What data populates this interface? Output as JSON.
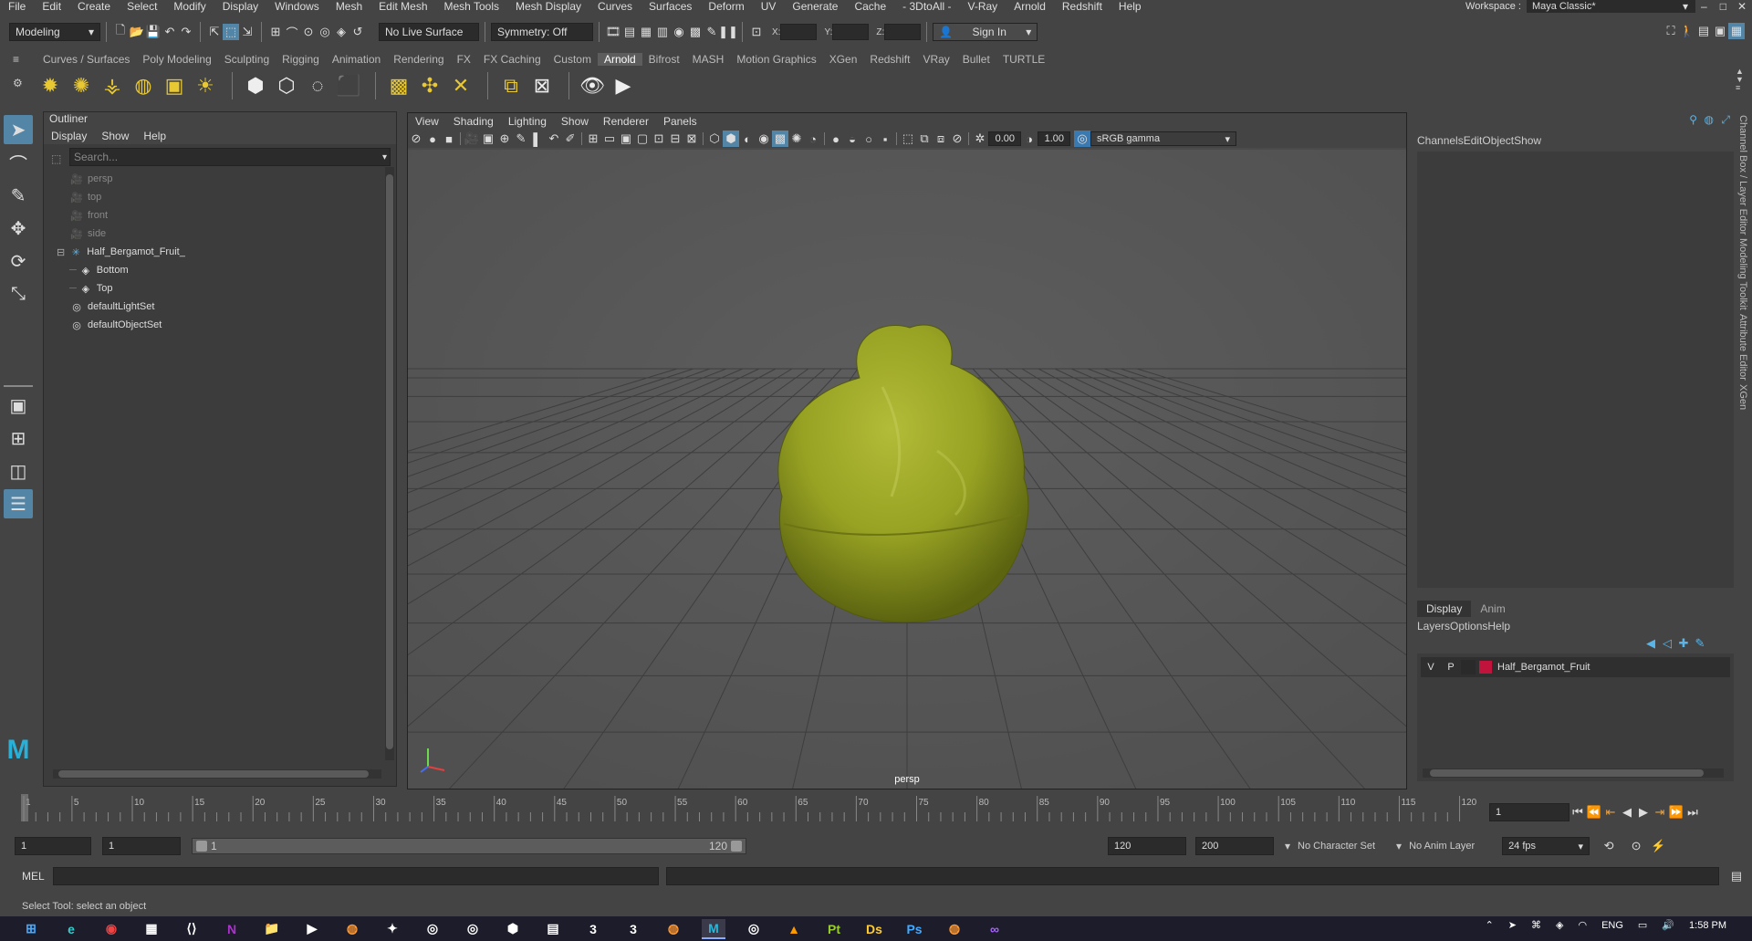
{
  "menubar": {
    "items": [
      "File",
      "Edit",
      "Create",
      "Select",
      "Modify",
      "Display",
      "Windows",
      "Mesh",
      "Edit Mesh",
      "Mesh Tools",
      "Mesh Display",
      "Curves",
      "Surfaces",
      "Deform",
      "UV",
      "Generate",
      "Cache",
      "- 3DtoAll -",
      "V-Ray",
      "Arnold",
      "Redshift",
      "Help"
    ],
    "workspace_label": "Workspace :",
    "workspace_value": "Maya Classic*"
  },
  "statusline": {
    "mode": "Modeling",
    "live_surface": "No Live Surface",
    "symmetry": "Symmetry: Off",
    "x_label": "X:",
    "y_label": "Y:",
    "z_label": "Z:",
    "sign_in": "Sign In"
  },
  "shelf": {
    "tabs": [
      "Curves / Surfaces",
      "Poly Modeling",
      "Sculpting",
      "Rigging",
      "Animation",
      "Rendering",
      "FX",
      "FX Caching",
      "Custom",
      "Arnold",
      "Bifrost",
      "MASH",
      "Motion Graphics",
      "XGen",
      "Redshift",
      "VRay",
      "Bullet",
      "TURTLE"
    ],
    "active_tab": "Arnold"
  },
  "outliner": {
    "title": "Outliner",
    "menu": [
      "Display",
      "Show",
      "Help"
    ],
    "search_placeholder": "Search...",
    "items": [
      {
        "label": "persp",
        "dim": true,
        "indent": 1,
        "icon": "camera-icon"
      },
      {
        "label": "top",
        "dim": true,
        "indent": 1,
        "icon": "camera-icon"
      },
      {
        "label": "front",
        "dim": true,
        "indent": 1,
        "icon": "camera-icon"
      },
      {
        "label": "side",
        "dim": true,
        "indent": 1,
        "icon": "camera-icon"
      },
      {
        "label": "Half_Bergamot_Fruit_",
        "dim": false,
        "indent": 0,
        "icon": "group-icon"
      },
      {
        "label": "Bottom",
        "dim": false,
        "indent": 2,
        "icon": "mesh-icon"
      },
      {
        "label": "Top",
        "dim": false,
        "indent": 2,
        "icon": "mesh-icon"
      },
      {
        "label": "defaultLightSet",
        "dim": false,
        "indent": 1,
        "icon": "set-icon"
      },
      {
        "label": "defaultObjectSet",
        "dim": false,
        "indent": 1,
        "icon": "set-icon"
      }
    ]
  },
  "viewport": {
    "menu": [
      "View",
      "Shading",
      "Lighting",
      "Show",
      "Renderer",
      "Panels"
    ],
    "exposure": "0.00",
    "gamma": "1.00",
    "color_space": "sRGB gamma",
    "camera_label": "persp",
    "object_color": "#9aa62a"
  },
  "channelbox": {
    "menu": [
      "Channels",
      "Edit",
      "Object",
      "Show"
    ]
  },
  "layereditor": {
    "tabs": [
      "Display",
      "Anim"
    ],
    "active_tab": "Display",
    "menu": [
      "Layers",
      "Options",
      "Help"
    ],
    "layer": {
      "v": "V",
      "p": "P",
      "name": "Half_Bergamot_Fruit",
      "color": "#c0143c"
    }
  },
  "sidetabs": [
    "Channel Box / Layer Editor",
    "Modeling Toolkit",
    "Attribute Editor",
    "XGen"
  ],
  "timeline": {
    "ticks": [
      "1",
      "5",
      "10",
      "15",
      "20",
      "25",
      "30",
      "35",
      "40",
      "45",
      "50",
      "55",
      "60",
      "65",
      "70",
      "75",
      "80",
      "85",
      "90",
      "95",
      "100",
      "105",
      "110",
      "115",
      "120"
    ],
    "current_frame": "1"
  },
  "range": {
    "start": "1",
    "playback_start": "1",
    "slider_start": "1",
    "slider_end": "120",
    "playback_end": "120",
    "end": "200",
    "character_set": "No Character Set",
    "anim_layer": "No Anim Layer",
    "fps": "24 fps"
  },
  "cmdline": {
    "label": "MEL"
  },
  "helpline": {
    "text": "Select Tool: select an object"
  },
  "taskbar": {
    "language": "ENG",
    "time": "1:58 PM",
    "apps": [
      "windows-start-icon",
      "edge-icon",
      "chrome-icon",
      "calculator-icon",
      "vscode-icon",
      "onenote-icon",
      "explorer-icon",
      "terminal-icon",
      "blender-icon",
      "app-icon",
      "obs-icon",
      "obs-icon-2",
      "app-icon-2",
      "app-icon-3",
      "app-3-icon",
      "app-3b-icon",
      "blender-icon-2",
      "maya-icon",
      "obs-icon-3",
      "vlc-icon",
      "pt-icon",
      "ds-icon",
      "photoshop-icon",
      "blender-icon-3",
      "visualstudio-icon"
    ]
  }
}
